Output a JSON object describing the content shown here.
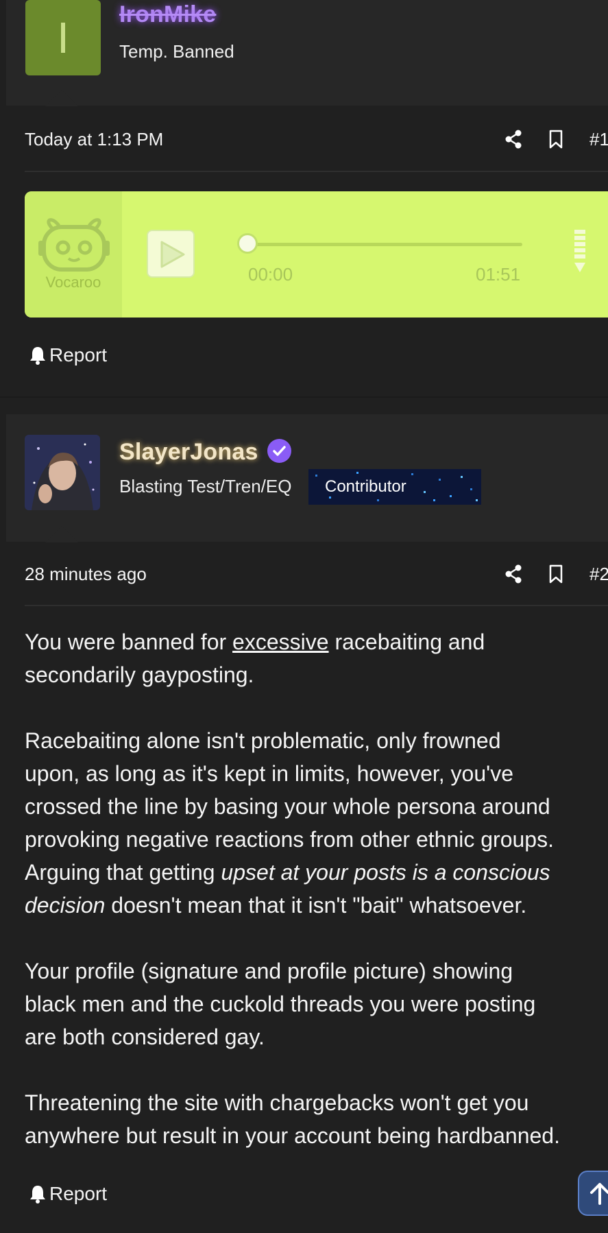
{
  "post1": {
    "avatar_letter": "I",
    "username": "IronMike",
    "user_title": "Temp. Banned",
    "timestamp": "Today at 1:13 PM",
    "post_number": "#1",
    "share_icon": "share-icon",
    "bookmark_icon": "bookmark-icon",
    "report_label": "Report"
  },
  "vocaroo": {
    "logo_text": "Vocaroo",
    "current_time": "00:00",
    "duration": "01:51",
    "progress": 0,
    "accent_color": "#d6f76f"
  },
  "post2": {
    "username": "SlayerJonas",
    "verified_icon": "verified-check-icon",
    "user_title": "Blasting Test/Tren/EQ",
    "badge": "Contributor",
    "timestamp": "28 minutes ago",
    "post_number": "#2",
    "paragraph1": {
      "before": "You were banned for ",
      "underlined": "excessive",
      "after": " racebaiting and",
      "line2": "secondarily gayposting."
    },
    "paragraph2": {
      "line1": "Racebaiting alone isn't problematic, only frowned",
      "line2": "upon, as long as it's kept in limits, however, you've",
      "line3": "crossed the line by basing your whole persona around",
      "line4": "provoking negative reactions from other ethnic groups.",
      "line5_before": "Arguing that getting ",
      "line5_italic": "upset at your posts is a conscious",
      "line6_italic": "decision",
      "line6_after": " doesn't mean that it isn't \"bait\" whatsoever."
    },
    "paragraph3": {
      "line1": "Your profile (signature and profile picture) showing",
      "line2": "black men and the cuckold threads you were posting",
      "line3": "are both considered gay."
    },
    "paragraph4": {
      "line1": "Threatening the site with chargebacks won't get you",
      "line2": "anywhere but result in your account being hardbanned."
    },
    "report_label": "Report"
  },
  "scroll_top_icon": "arrow-up-icon"
}
